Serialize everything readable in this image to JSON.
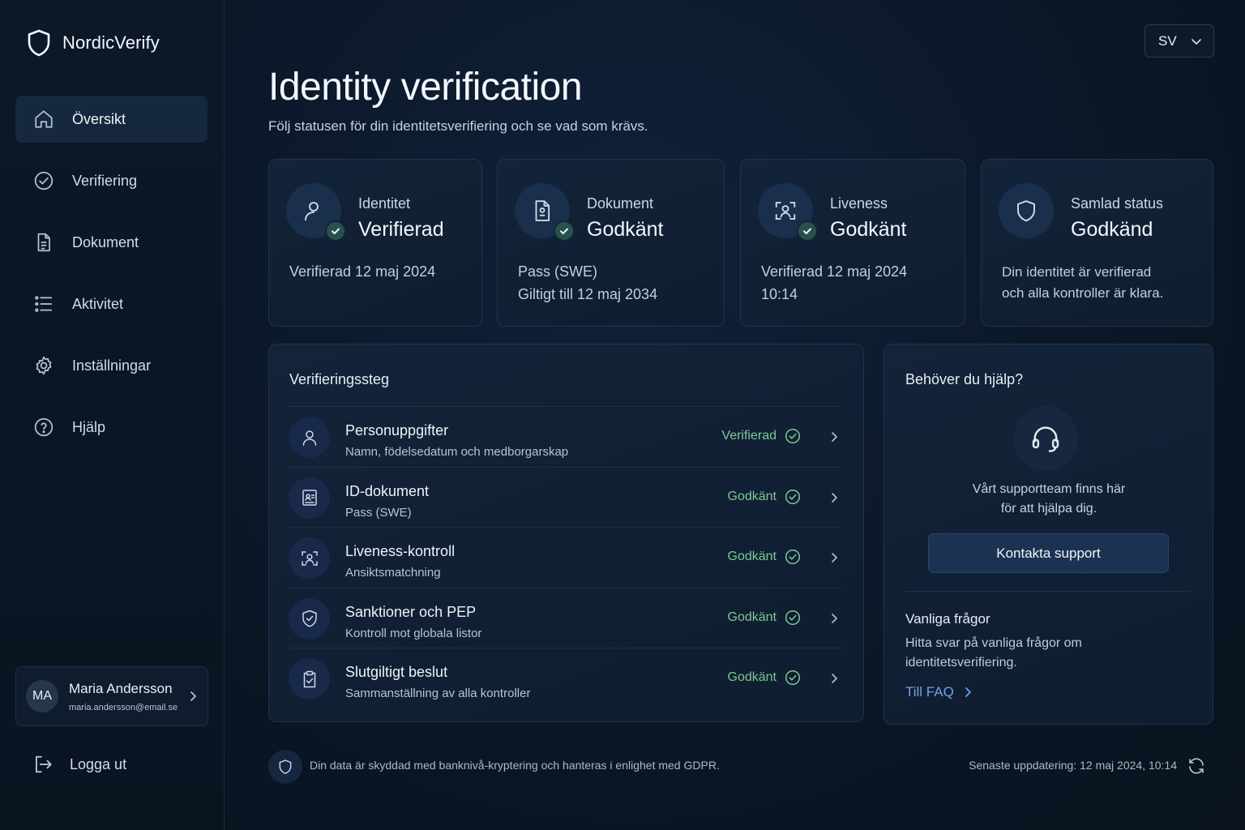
{
  "brand": {
    "name": "NordicVerify"
  },
  "sidebar": {
    "items": [
      {
        "label": "Översikt",
        "icon": "home-icon",
        "active": true
      },
      {
        "label": "Verifiering",
        "icon": "check-circle-icon"
      },
      {
        "label": "Dokument",
        "icon": "document-icon"
      },
      {
        "label": "Aktivitet",
        "icon": "list-icon"
      },
      {
        "label": "Inställningar",
        "icon": "gear-icon"
      },
      {
        "label": "Hjälp",
        "icon": "help-icon"
      }
    ],
    "user": {
      "initials": "MA",
      "name": "Maria Andersson",
      "email": "maria.andersson@email.se"
    },
    "logout_label": "Logga ut"
  },
  "header": {
    "language": "SV",
    "title": "Identity verification",
    "subtitle": "Följ statusen för din identitetsverifiering och se vad som krävs."
  },
  "stats": [
    {
      "label": "Identitet",
      "value": "Verifierad",
      "detail_lines": [
        "Verifierad 12 maj 2024"
      ],
      "icon": "user-icon"
    },
    {
      "label": "Dokument",
      "value": "Godkänt",
      "detail_lines": [
        "Pass (SWE)",
        "Giltigt till 12 maj 2034"
      ],
      "icon": "passport-icon"
    },
    {
      "label": "Liveness",
      "value": "Godkänt",
      "detail_lines": [
        "Verifierad 12 maj 2024",
        "10:14"
      ],
      "icon": "face-scan-icon"
    },
    {
      "label": "Samlad status",
      "value": "Godkänd",
      "detail_lines": [
        "Din identitet är verifierad",
        "och alla kontroller är klara."
      ],
      "icon": "shield-icon"
    }
  ],
  "steps": {
    "title": "Verifieringssteg",
    "items": [
      {
        "title": "Personuppgifter",
        "subtitle": "Namn, födelsedatum och medborgarskap",
        "status": "Verifierad",
        "icon": "user-icon"
      },
      {
        "title": "ID-dokument",
        "subtitle": "Pass (SWE)",
        "status": "Godkänt",
        "icon": "id-card-icon"
      },
      {
        "title": "Liveness-kontroll",
        "subtitle": "Ansiktsmatchning",
        "status": "Godkänt",
        "icon": "face-scan-icon"
      },
      {
        "title": "Sanktioner och PEP",
        "subtitle": "Kontroll mot globala listor",
        "status": "Godkänt",
        "icon": "shield-check-icon"
      },
      {
        "title": "Slutgiltigt beslut",
        "subtitle": "Sammanställning av alla kontroller",
        "status": "Godkänt",
        "icon": "clipboard-check-icon"
      }
    ]
  },
  "help": {
    "title": "Behöver du hjälp?",
    "text_lines": [
      "Vårt supportteam finns här",
      "för att hjälpa dig."
    ],
    "button": "Kontakta support",
    "faq_title": "Vanliga frågor",
    "faq_text": "Hitta svar på vanliga frågor om identitetsverifiering.",
    "faq_link": "Till FAQ"
  },
  "footer": {
    "security_text": "Din data är skyddad med banknivå-kryptering och hanteras i enlighet med GDPR.",
    "updated": "Senaste uppdatering: 12 maj 2024, 10:14"
  },
  "colors": {
    "accent_green": "#7fc896",
    "link_blue": "#6ea4e6",
    "background": "#0b1523"
  }
}
